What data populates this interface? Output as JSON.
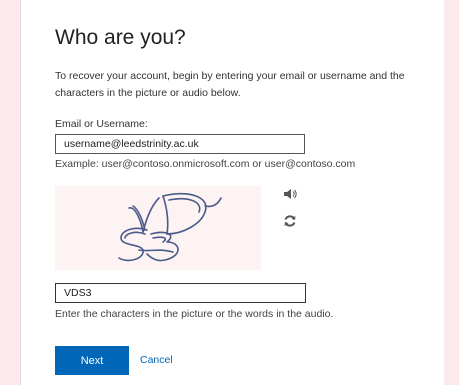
{
  "page": {
    "title": "Who are you?",
    "intro": "To recover your account, begin by entering your email or username and the characters in the picture or audio below."
  },
  "email": {
    "label": "Email or Username:",
    "value": "username@leedstrinity.ac.uk",
    "example": "Example: user@contoso.onmicrosoft.com or user@contoso.com"
  },
  "captcha": {
    "text": "VDS3",
    "audio_icon": "speaker-icon",
    "refresh_icon": "refresh-icon"
  },
  "code": {
    "value": "VDS3",
    "hint": "Enter the characters in the picture or the words in the audio."
  },
  "actions": {
    "next_label": "Next",
    "cancel_label": "Cancel"
  },
  "colors": {
    "background": "#fbe9ec",
    "primary": "#0067b8",
    "captcha_bg": "#fdf3f3",
    "captcha_ink": "#4a5a8a"
  }
}
